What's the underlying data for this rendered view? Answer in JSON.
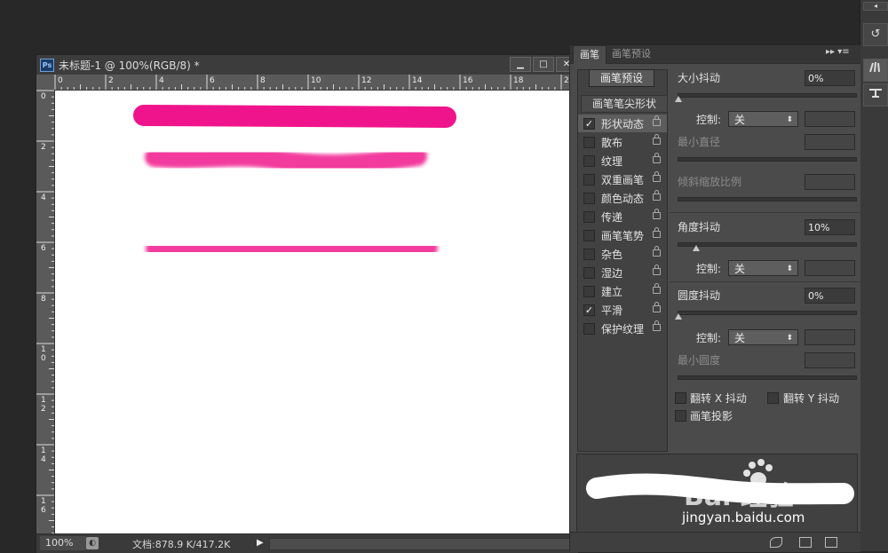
{
  "document": {
    "app_badge": "Ps",
    "title": "未标题-1 @ 100%(RGB/8) *",
    "ruler_top_labels": [
      "0",
      "2",
      "4",
      "6",
      "8",
      "10",
      "12",
      "14",
      "16",
      "18",
      "20"
    ],
    "ruler_left_labels": [
      "0",
      "2",
      "4",
      "6",
      "8",
      "10",
      "12",
      "14",
      "16"
    ],
    "canvas_bg": "#ffffff",
    "stroke_color": "#f0148c",
    "status": {
      "zoom": "100%",
      "doc_info": "文档:878.9 K/417.2K",
      "arrow": "▶"
    },
    "window_buttons": {
      "minimize": "▁",
      "maximize": "□",
      "close": "✕"
    }
  },
  "panel": {
    "tabs": [
      {
        "label": "画笔",
        "active": true
      },
      {
        "label": "画笔预设",
        "active": false
      }
    ],
    "menu_glyph": "▸▸ ▾≡",
    "preset_button": "画笔预设",
    "tip_shape": "画笔笔尖形状",
    "options": [
      {
        "label": "形状动态",
        "checked": true,
        "selected": true
      },
      {
        "label": "散布",
        "checked": false
      },
      {
        "label": "纹理",
        "checked": false
      },
      {
        "label": "双重画笔",
        "checked": false
      },
      {
        "label": "颜色动态",
        "checked": false
      },
      {
        "label": "传递",
        "checked": false
      },
      {
        "label": "画笔笔势",
        "checked": false
      },
      {
        "label": "杂色",
        "checked": false
      },
      {
        "label": "湿边",
        "checked": false
      },
      {
        "label": "建立",
        "checked": false
      },
      {
        "label": "平滑",
        "checked": true
      },
      {
        "label": "保护纹理",
        "checked": false
      }
    ],
    "check_mark": "✓",
    "size_jitter": {
      "label": "大小抖动",
      "value": "0%",
      "level": 0.0
    },
    "control_label": "控制:",
    "control_value": "关",
    "caret": "⬍",
    "min_diameter": {
      "label": "最小直径"
    },
    "tilt_scale": {
      "label": "倾斜缩放比例"
    },
    "angle_jitter": {
      "label": "角度抖动",
      "value": "10%",
      "level": 0.1
    },
    "roundness_jitter": {
      "label": "圆度抖动",
      "value": "0%",
      "level": 0.0
    },
    "min_roundness": {
      "label": "最小圆度"
    },
    "flip_x": "翻转 X 抖动",
    "flip_y": "翻转 Y 抖动",
    "brush_projection": "画笔投影",
    "preview_stroke_color": "#ffffff"
  },
  "watermark": {
    "logo": "Bai 经验",
    "url": "jingyan.baidu.com"
  },
  "dock": {
    "icons": [
      "brush-preset-icon",
      "clone-source-icon",
      "brush-icon",
      "tool-preset-icon"
    ]
  }
}
